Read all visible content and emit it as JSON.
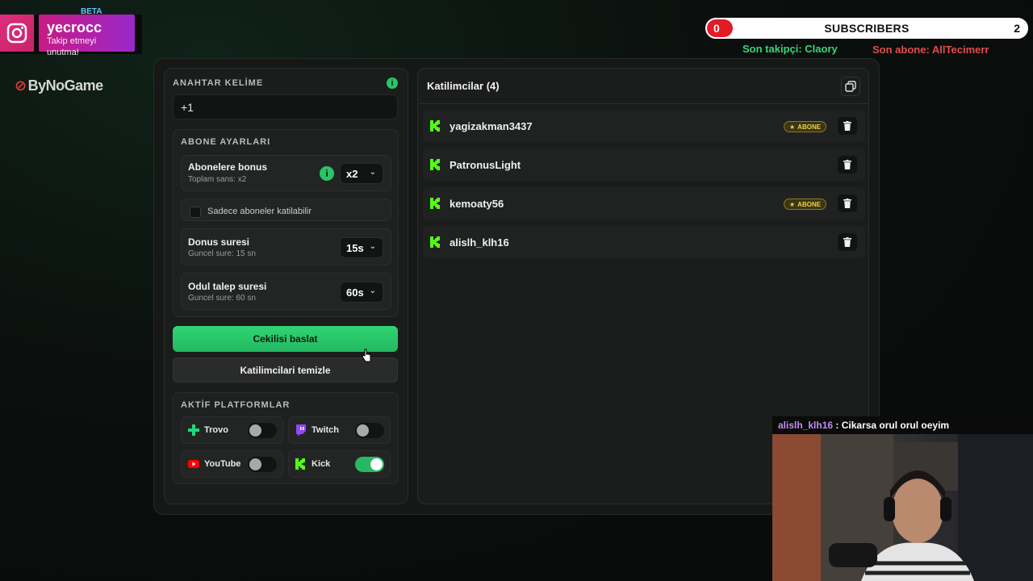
{
  "overlay": {
    "beta_label": "BETA",
    "instagram": {
      "handle": "yecrocc",
      "subtitle": "Takip etmeyi unutma!"
    },
    "brand_text": "ByNoGame",
    "subscribers": {
      "left_count": "0",
      "label": "SUBSCRIBERS",
      "right_count": "2",
      "progress": 0.08,
      "bar_color": "#e21b26"
    },
    "last_follower": "Son takipçi: Claory",
    "last_subscriber": "Son abone: AllTecimerr"
  },
  "keyword": {
    "title": "ANAHTAR KELİME",
    "value": "+1",
    "info_icon": "info-icon"
  },
  "subscriber_settings": {
    "title": "ABONE AYARLARI",
    "bonus": {
      "label": "Abonelere bonus",
      "sub": "Toplam sans: x2",
      "value": "x2"
    },
    "only_subs": {
      "label": "Sadece aboneler katilabilir",
      "checked": false
    },
    "spin_time": {
      "label": "Donus suresi",
      "sub": "Guncel sure: 15 sn",
      "value": "15s"
    },
    "claim_time": {
      "label": "Odul talep suresi",
      "sub": "Guncel sure: 60 sn",
      "value": "60s"
    }
  },
  "actions": {
    "start_label": "Cekilisi baslat",
    "clear_label": "Katilimcilari temizle"
  },
  "platforms": {
    "title": "AKTİF PLATFORMLAR",
    "items": [
      {
        "name": "Trovo",
        "enabled": false,
        "icon": "trovo-icon",
        "color": "#1fd67a"
      },
      {
        "name": "Twitch",
        "enabled": false,
        "icon": "twitch-icon",
        "color": "#9146ff"
      },
      {
        "name": "YouTube",
        "enabled": false,
        "icon": "youtube-icon",
        "color": "#ff0000"
      },
      {
        "name": "Kick",
        "enabled": true,
        "icon": "kick-icon",
        "color": "#53fc18"
      }
    ]
  },
  "participants": {
    "title": "Katilimcilar (4)",
    "badge_label": "ABONE",
    "list": [
      {
        "name": "yagizakman3437",
        "subscriber": true
      },
      {
        "name": "PatronusLight",
        "subscriber": false
      },
      {
        "name": "kemoaty56",
        "subscriber": true
      },
      {
        "name": "alislh_klh16",
        "subscriber": false
      }
    ]
  },
  "chat": {
    "user": "alislh_klh16",
    "separator": " : ",
    "message": "Cikarsa orul orul oeyim"
  },
  "colors": {
    "accent_green": "#27c566",
    "kick_green": "#53fc18",
    "badge_gold": "#f4cf3a"
  }
}
